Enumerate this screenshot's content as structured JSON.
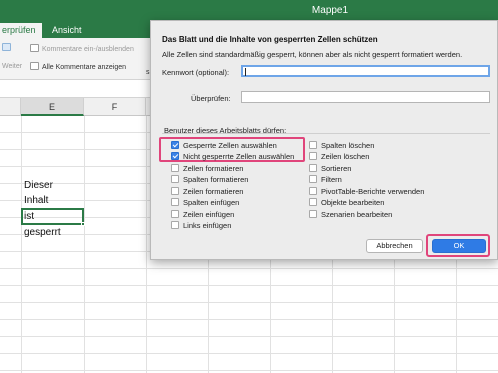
{
  "window": {
    "title": "Mappe1"
  },
  "ribbon": {
    "tabs": [
      {
        "label": "erprüfen",
        "active": true
      },
      {
        "label": "Ansicht",
        "active": false
      }
    ],
    "comments_toggle": "Kommentare ein-/ausblenden",
    "weiter": "Weiter",
    "all_comments": "Alle Kommentare anzeigen",
    "truncated": "s"
  },
  "grid": {
    "columns": [
      "E",
      "F"
    ],
    "selected_column": "E",
    "cells": [
      "Dieser",
      "Inhalt",
      "ist",
      "gesperrt"
    ]
  },
  "dialog": {
    "title": "Das Blatt und die Inhalte von gesperrten Zellen schützen",
    "info": "Alle Zellen sind standardmäßig gesperrt, können aber als nicht gesperrt formatiert werden.",
    "password_label": "Kennwort (optional):",
    "password_value": "",
    "verify_label": "Überprüfen:",
    "verify_value": "",
    "section_label": "Benutzer dieses Arbeitsblatts dürfen:",
    "left_options": [
      {
        "label": "Gesperrte Zellen auswählen",
        "checked": true
      },
      {
        "label": "Nicht gesperrte Zellen auswählen",
        "checked": true
      },
      {
        "label": "Zellen formatieren",
        "checked": false
      },
      {
        "label": "Spalten formatieren",
        "checked": false
      },
      {
        "label": "Zeilen formatieren",
        "checked": false
      },
      {
        "label": "Spalten einfügen",
        "checked": false
      },
      {
        "label": "Zeilen einfügen",
        "checked": false
      },
      {
        "label": "Links einfügen",
        "checked": false
      }
    ],
    "right_options": [
      {
        "label": "Spalten löschen",
        "checked": false
      },
      {
        "label": "Zeilen löschen",
        "checked": false
      },
      {
        "label": "Sortieren",
        "checked": false
      },
      {
        "label": "Filtern",
        "checked": false
      },
      {
        "label": "PivotTable-Berichte verwenden",
        "checked": false
      },
      {
        "label": "Objekte bearbeiten",
        "checked": false
      },
      {
        "label": "Szenarien bearbeiten",
        "checked": false
      }
    ],
    "cancel_label": "Abbrechen",
    "ok_label": "OK"
  },
  "colors": {
    "excel_green": "#2b7a46",
    "highlight": "#e0457b",
    "checkbox_blue": "#3b82e6",
    "ok_blue": "#2f7be5"
  }
}
